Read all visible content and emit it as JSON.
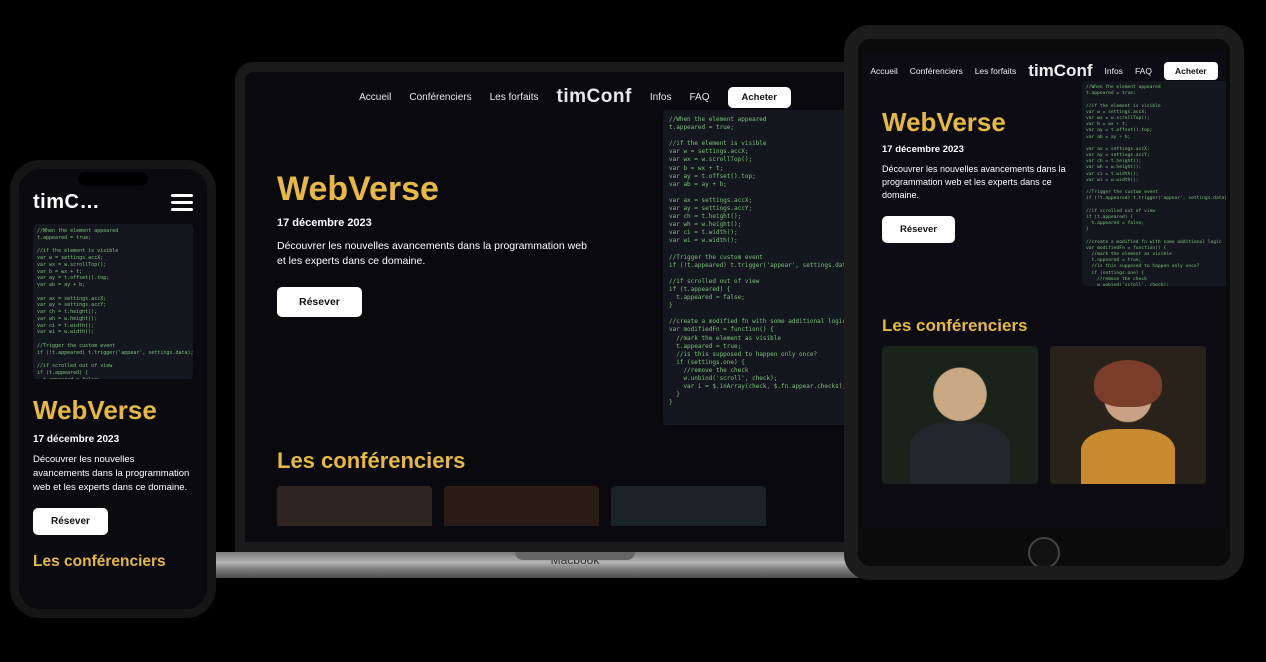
{
  "brand": "timConf",
  "laptop_base_label": "Macbook",
  "nav": {
    "accueil": "Accueil",
    "conferenciers": "Conférenciers",
    "forfaits": "Les forfaits",
    "infos": "Infos",
    "faq": "FAQ",
    "acheter": "Acheter"
  },
  "hero": {
    "title": "WebVerse",
    "date": "17 décembre 2023",
    "description": "Découvrer les nouvelles avancements dans la programmation web et les experts dans ce domaine.",
    "cta": "Résever"
  },
  "section_speakers": "Les conférenciers",
  "phone_brand_truncated": "timC…",
  "code_sample": "//When the element appeared\nt.appeared = true;\n\n//if the element is visible\nvar w = settings.accX;\nvar wx = w.scrollTop();\nvar b = wx + t;\nvar ay = t.offset().top;\nvar ab = ay + b;\n\nvar ax = settings.accX;\nvar ay = settings.accY;\nvar ch = t.height();\nvar wh = w.height();\nvar ci = t.width();\nvar wi = w.width();\n\n//Trigger the custom event\nif (!t.appeared) t.trigger('appear', settings.data);\n\n//if scrolled out of view\nif (t.appeared) {\n  t.appeared = false;\n}\n\n//create a modified fn with some additional logic\nvar modifiedFn = function() {\n  //mark the element as visible\n  t.appeared = true;\n  //is this supposed to happen only once?\n  if (settings.one) {\n    //remove the check\n    w.unbind('scroll', check);\n    var i = $.inArray(check, $.fn.appear.checks);\n  }\n}"
}
